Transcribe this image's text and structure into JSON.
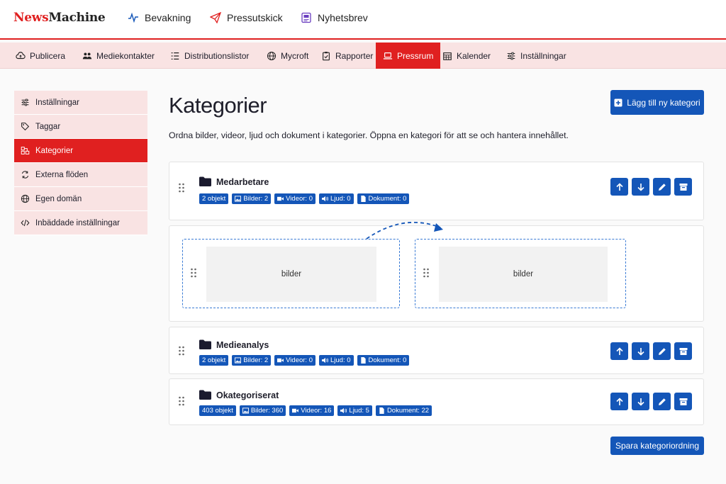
{
  "brand": {
    "part1": "News",
    "part2": "Machine"
  },
  "topnav": [
    {
      "label": "Bevakning",
      "icon": "pulse-icon"
    },
    {
      "label": "Pressutskick",
      "icon": "paper-plane-icon"
    },
    {
      "label": "Nyhetsbrev",
      "icon": "newsletter-icon"
    }
  ],
  "subnav": [
    {
      "label": "Publicera",
      "icon": "cloud-upload-icon"
    },
    {
      "label": "Mediekontakter",
      "icon": "users-icon"
    },
    {
      "label": "Distributionslistor",
      "icon": "list-icon"
    },
    {
      "label": "Mycroft",
      "icon": "globe-icon"
    },
    {
      "label": "Rapporter",
      "icon": "clipboard-icon"
    },
    {
      "label": "Pressrum",
      "icon": "laptop-icon",
      "active": true
    },
    {
      "label": "Kalender",
      "icon": "calendar-icon"
    },
    {
      "label": "Inställningar",
      "icon": "sliders-icon"
    }
  ],
  "sidebar": [
    {
      "label": "Inställningar",
      "icon": "sliders-icon"
    },
    {
      "label": "Taggar",
      "icon": "tag-icon"
    },
    {
      "label": "Kategorier",
      "icon": "categories-icon",
      "active": true
    },
    {
      "label": "Externa flöden",
      "icon": "sync-icon"
    },
    {
      "label": "Egen domän",
      "icon": "globe-icon"
    },
    {
      "label": "Inbäddade inställningar",
      "icon": "code-icon"
    }
  ],
  "main": {
    "title": "Kategorier",
    "description": "Ordna bilder, videor, ljud och dokument i kategorier. Öppna en kategori för att se och hantera innehållet.",
    "add_button": "Lägg till ny kategori",
    "save_button": "Spara kategoriordning"
  },
  "categories": [
    {
      "name": "Medarbetare",
      "badges": {
        "count": "2 objekt",
        "images": "Bilder: 2",
        "videos": "Videor: 0",
        "audio": "Ljud: 0",
        "docs": "Dokument: 0"
      }
    },
    {
      "name": "Medieanalys",
      "badges": {
        "count": "2 objekt",
        "images": "Bilder: 2",
        "videos": "Videor: 0",
        "audio": "Ljud: 0",
        "docs": "Dokument: 0"
      }
    },
    {
      "name": "Okategoriserat",
      "badges": {
        "count": "403 objekt",
        "images": "Bilder: 360",
        "videos": "Videor: 16",
        "audio": "Ljud: 5",
        "docs": "Dokument: 22"
      }
    }
  ],
  "drag_preview": {
    "left_label": "bilder",
    "right_label": "bilder"
  },
  "colors": {
    "brand_red": "#e02020",
    "primary_blue": "#1456b8",
    "nav_bg": "#f9e3e3"
  }
}
